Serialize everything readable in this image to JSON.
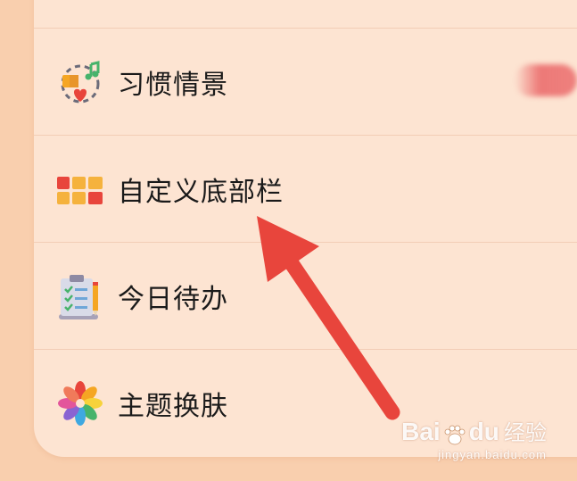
{
  "settings": {
    "items": [
      {
        "label": "习惯情景",
        "icon": "habit-scene-icon"
      },
      {
        "label": "自定义底部栏",
        "icon": "custom-bottom-bar-icon"
      },
      {
        "label": "今日待办",
        "icon": "todo-clipboard-icon"
      },
      {
        "label": "主题换肤",
        "icon": "theme-flower-icon"
      }
    ]
  },
  "annotation": {
    "arrow_color": "#e8453c"
  },
  "watermark": {
    "brand": "Bai",
    "brand_suffix": "du",
    "cn": "经验",
    "url": "jingyan.baidu.com"
  }
}
